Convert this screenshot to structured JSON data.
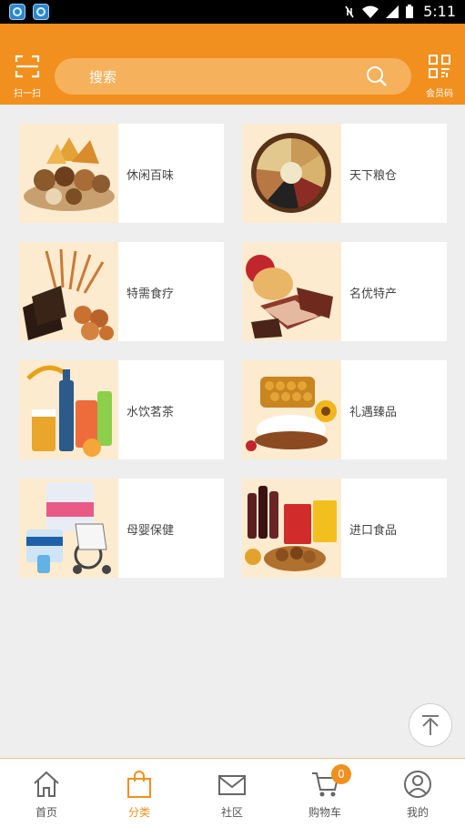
{
  "status_bar": {
    "time": "5:11"
  },
  "header": {
    "scan_label": "扫一扫",
    "search_placeholder": "搜索",
    "member_label": "会员码"
  },
  "categories": [
    {
      "label": "休闲百味",
      "image": "snack-nuts-image"
    },
    {
      "label": "天下粮仓",
      "image": "grains-tray-image"
    },
    {
      "label": "特需食疗",
      "image": "cordyceps-image"
    },
    {
      "label": "名优特产",
      "image": "specialty-meat-image"
    },
    {
      "label": "水饮茗茶",
      "image": "drinks-image"
    },
    {
      "label": "礼遇臻品",
      "image": "honey-gift-image"
    },
    {
      "label": "母婴保健",
      "image": "baby-products-image"
    },
    {
      "label": "进口食品",
      "image": "imported-food-image"
    }
  ],
  "tabbar": {
    "items": [
      {
        "label": "首页",
        "icon": "home-icon"
      },
      {
        "label": "分类",
        "icon": "category-bag-icon"
      },
      {
        "label": "社区",
        "icon": "mail-icon"
      },
      {
        "label": "购物车",
        "icon": "cart-icon",
        "badge": "0"
      },
      {
        "label": "我的",
        "icon": "profile-icon"
      }
    ],
    "active": "分类"
  },
  "colors": {
    "accent": "#f1901e",
    "background": "#eeeeee"
  }
}
